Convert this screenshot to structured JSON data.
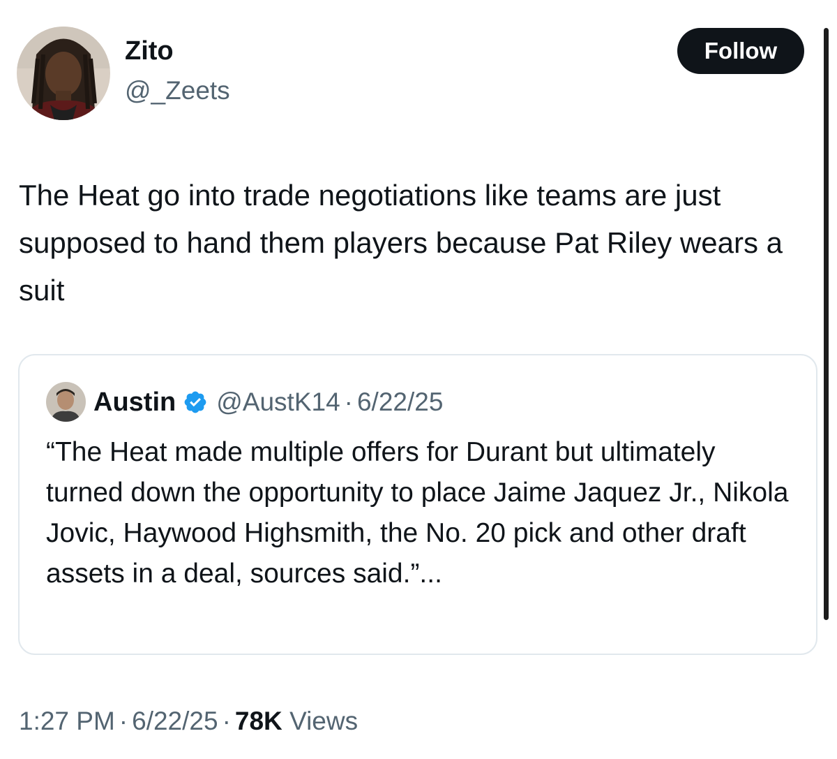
{
  "author": {
    "name": "Zito",
    "handle": "@_Zeets",
    "avatar_icon": "user-avatar-photo"
  },
  "actions": {
    "follow_label": "Follow"
  },
  "tweet": {
    "text": "The Heat go into trade negotiations like teams are just supposed to hand them players because Pat Riley wears a suit"
  },
  "quoted": {
    "name": "Austin",
    "verified_icon": "verified-badge-icon",
    "handle": "@AustK14",
    "separator": "·",
    "date": "6/22/25",
    "text": "“The Heat made multiple offers for Durant but ultimately turned down the opportunity to place Jaime Jaquez Jr., Nikola Jovic, Haywood Highsmith, the No. 20 pick and other draft assets in a deal, sources said.”..."
  },
  "meta": {
    "time": "1:27 PM",
    "separator": "·",
    "date": "6/22/25",
    "views_count": "78K",
    "views_label": "Views"
  },
  "colors": {
    "text_primary": "#0f1419",
    "text_secondary": "#536471",
    "verified_blue": "#1d9bf0",
    "border": "#e1e8ed"
  }
}
